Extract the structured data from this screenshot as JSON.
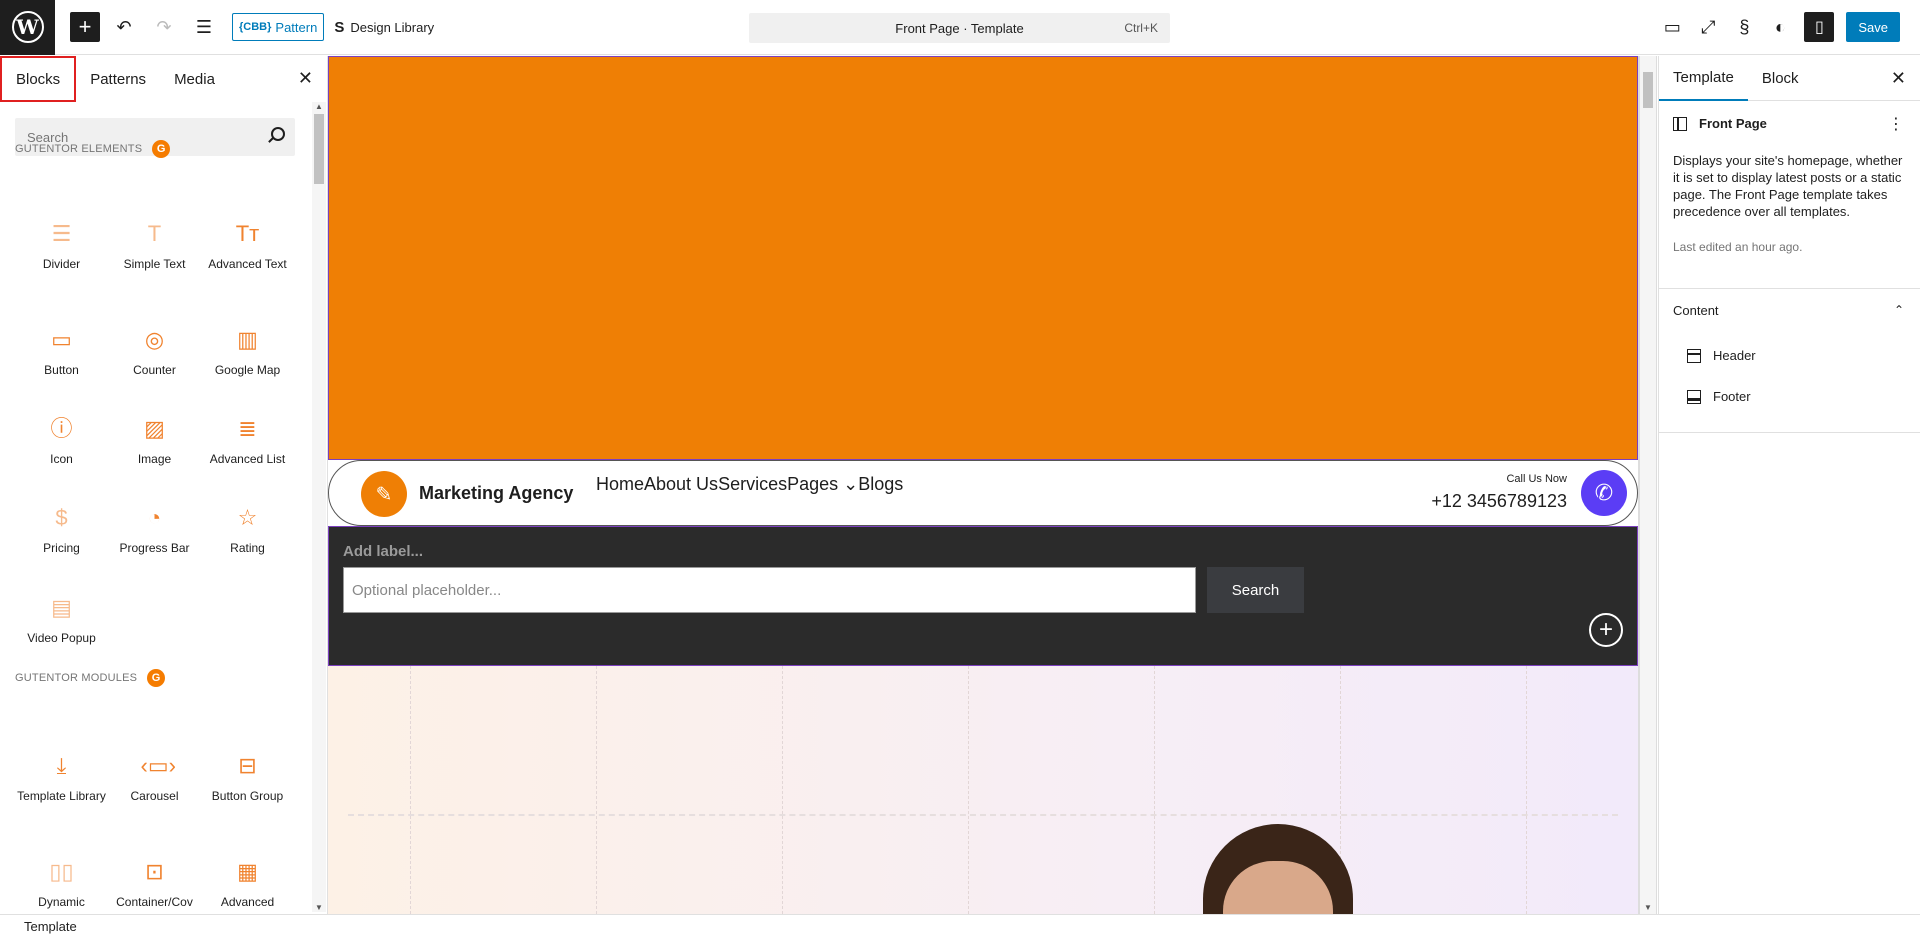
{
  "topbar": {
    "pattern_label": "Pattern",
    "pattern_prefix": "{CBB}",
    "design_library": "Design Library",
    "command_title": "Front Page · Template",
    "command_shortcut": "Ctrl+K",
    "save_label": "Save"
  },
  "inserter": {
    "tabs": [
      "Blocks",
      "Patterns",
      "Media"
    ],
    "search_placeholder": "Search",
    "category_elements": "GUTENTOR ELEMENTS",
    "category_modules": "GUTENTOR MODULES",
    "elements": [
      "Divider",
      "Simple Text",
      "Advanced Text",
      "Button",
      "Counter",
      "Google Map",
      "Icon",
      "Image",
      "Advanced List",
      "Pricing",
      "Progress Bar",
      "Rating",
      "Video Popup"
    ],
    "modules": [
      "Template Library",
      "Carousel",
      "Button Group",
      "Dynamic",
      "Container/Cov",
      "Advanced"
    ]
  },
  "canvas": {
    "brand": "Marketing Agency",
    "nav": [
      "Home",
      "About Us",
      "Services",
      "Pages ⌄",
      "Blogs"
    ],
    "call_label": "Call Us Now",
    "phone": "+12 3456789123",
    "search_label": "Add label...",
    "search_placeholder": "Optional placeholder...",
    "search_button": "Search"
  },
  "settings": {
    "tabs": [
      "Template",
      "Block"
    ],
    "template_name": "Front Page",
    "description": "Displays your site's homepage, whether it is set to display latest posts or a static page. The Front Page template takes precedence over all templates.",
    "last_edited": "Last edited an hour ago.",
    "content_label": "Content",
    "parts": [
      "Header",
      "Footer"
    ]
  },
  "footer": {
    "breadcrumb": "Template"
  },
  "colors": {
    "accent": "#007cba",
    "orange": "#ef7f05",
    "dark": "#2b2b2b",
    "phone": "#5b3df5"
  }
}
